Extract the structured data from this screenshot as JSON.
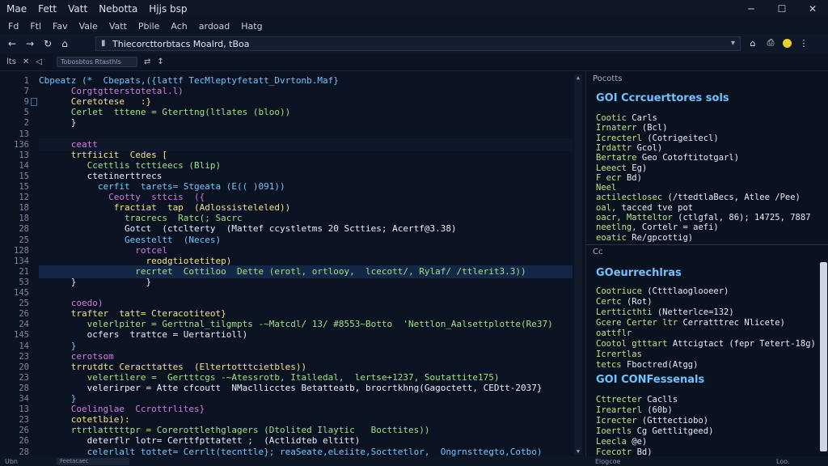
{
  "titlebar": {
    "menu": [
      "Mae",
      "Fett",
      "Vatt",
      "Nebotta",
      "Hjjs bsp"
    ],
    "controls": {
      "minimize": "─",
      "maximize": "☐",
      "close": "✕"
    }
  },
  "menubar": [
    "Fd",
    "Ftl",
    "Fav",
    "Vale",
    "Vatt",
    "Pbile",
    "Ach",
    "ardoad",
    "Hatg"
  ],
  "nav": {
    "back": "←",
    "forward": "→",
    "refresh": "↻",
    "home_glyph": "⌂",
    "address": "Thiecorcttorbtacs Moalrd, tBoa",
    "icons": [
      "⌂",
      "⎙",
      "●",
      "⋮"
    ]
  },
  "toolbar": {
    "items": [
      "lts",
      "✕",
      "◁",
      "▭",
      "⇄",
      "↕"
    ],
    "tab_label": "Tobosbtos Rtasthls"
  },
  "gutter": [
    "1",
    "7",
    "9",
    "5",
    "2",
    "13",
    "136",
    "13",
    "14",
    "15",
    "15",
    "12",
    "18",
    "18",
    "28",
    "25",
    "128",
    "134",
    "21",
    "53",
    "145",
    "25",
    "26",
    "24",
    "145",
    "14",
    "23",
    "20",
    "23",
    "28",
    "34",
    "13",
    "23",
    "26",
    "26",
    "28"
  ],
  "code": [
    "Cbpeatz (*  Cbepats,({lattf TecMleptyfetatt_Dvrtonb.Maf}",
    "      Corgtgtterstotetal.l)",
    "      Ceretotese   :}",
    "      Cerlet  tttene = Gterttng(ltlates (bloo))",
    "      }",
    "",
    "      ceatt",
    "      trtfiicit  Cedes [",
    "         Ccettlis tcttieecs (Blip)",
    "         ctetinerttrecs",
    "           cerfit  tarets= Stgeata (E(( )091))",
    "             Ceotty  sttcis  ({",
    "              fractiat  tap  (Adlossisteleled))",
    "                tracrecs  Ratc(; Sacrc",
    "                Gotct  (ctclterty  (Mattef ccystletms 20 Sctties; Acertf@3.38)",
    "                Geesteltt  (Neces)",
    "                  rotcel",
    "                    reodgtiotetitep)",
    "                  recrtet  Cottiloo  Dette (erotl, ortlooy,  lcecott/, Rylaf/ /ttlerit3.3))",
    "      }             }",
    "",
    "      coedo)",
    "      trafter  tatt= Cteracotiteot}",
    "         velerlpiter = Gerttnal_tilgmpts -~Matcdl/ 13/ #8553~Botto  'Nettlon_Aalsettplotte(Re37)",
    "         ocfers  trattce = Uertartioll)",
    "      }",
    "      cerotsom",
    "      trrutdtc Ceracttattes  (Eltertotttcietbles))",
    "         velertilere =  Gertttcgs -~Atessrotb, Italledal,  lertse+1237, Soutattite175)",
    "         velerirper = Atte cfcoutt  NMacllicctes Betatteatb, brocrtkhng(Gagoctett, CEDtt-2037}",
    "      }",
    "      Coelinglae  Ccrottrlites}",
    "      cotetlbie):",
    "      rtrtlatttttpr = Corerottlethglagers (Dtolited Ilaytic   Bocttites))",
    "         deterflr lotr= Certtfpttatett ;  (Actlidteb eltitt)",
    "         celerlalt tottet= Cerrlt(tecnttle}; reaSeate,eLeiite,Socttetlor,  Ongrnsttegto,Cotbo)"
  ],
  "right": {
    "header1": "Pocotts",
    "section1_title": "GOI  Ccrcuerttores sols",
    "section1": [
      [
        "Cootic  ",
        "Carls"
      ],
      [
        "Irnaterr ",
        "(Bcl)"
      ],
      [
        "Icrecterl  ",
        "(Cotrigeitecl)"
      ],
      [
        "Irdattr ",
        "Gcol)"
      ],
      [
        "Bertatre  ",
        "Geo Cotoftitotgarl)"
      ],
      [
        "Leeect ",
        "Eg)"
      ],
      [
        "F ecr ",
        "Bd)"
      ],
      [
        "Neel",
        ""
      ],
      [
        "actilectlosec  ",
        "(/ttedtlaBecs, Atlee /Pee)"
      ],
      [
        "oal, ",
        "tacced tve  pot"
      ],
      [
        "oacr,  Matteltor ",
        "(ctlgfal, 86); 14725, 7887"
      ],
      [
        "neetlng,  ",
        "Cortelr  =  aefi)"
      ],
      [
        "eoatic  ",
        "Re/gpcottig)"
      ]
    ],
    "header2": "Cc",
    "section2_title": "GOeurrechlras",
    "section2": [
      [
        "Cootriuce ",
        "(Ctttlaoglooeer)"
      ],
      [
        "Certc  ",
        "(Rot)"
      ],
      [
        "Lertticthti ",
        "(Netterlce=132)"
      ],
      [
        "Gcere  Certer  ltr ",
        "Cerratttrec  Nlicete)"
      ],
      [
        "oattflr",
        ""
      ],
      [
        "Cootol gtttart ",
        "Attcigtact (fepr Tetert-18g)"
      ],
      [
        "Icrertlas",
        ""
      ],
      [
        "tetcs  ",
        "Fboctred(Atgg)"
      ]
    ],
    "section3_title": "GOI  CONFessenals",
    "section3": [
      [
        "Cttrecter ",
        "Caclls"
      ],
      [
        "Irearterl ",
        "(60b)"
      ],
      [
        "Icrecter  ",
        "(Gtttectiobo)"
      ],
      [
        "Ioertls ",
        "Cg Gettlitgeed)"
      ],
      [
        "Leecla  ",
        "@e)"
      ],
      [
        "Fcecotr ",
        "Bd)"
      ]
    ]
  },
  "status": {
    "left": "Ubn",
    "chip": "Feetacaec",
    "mid": "Elogcoe",
    "right": "Loo."
  }
}
